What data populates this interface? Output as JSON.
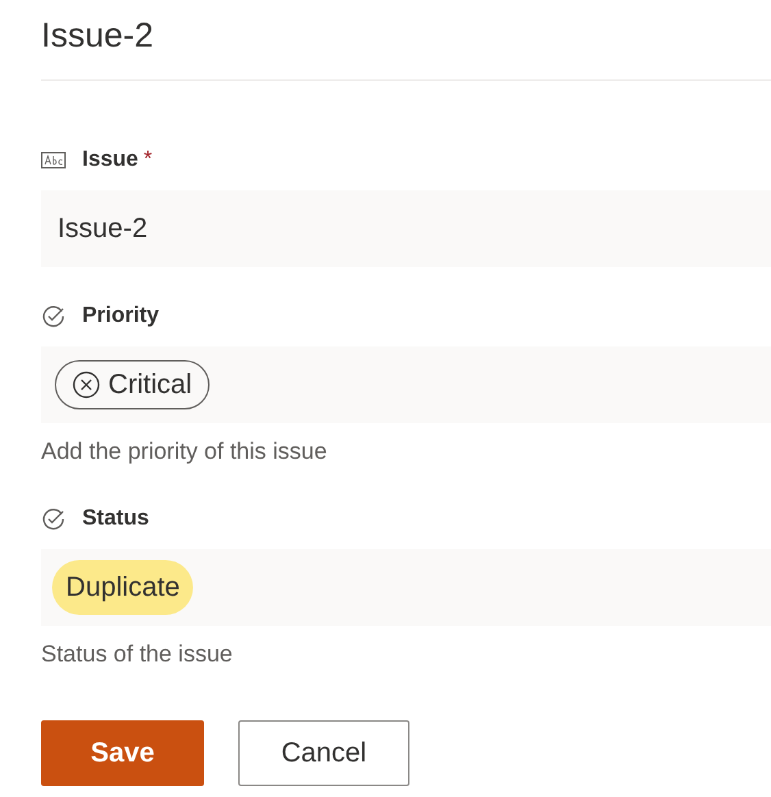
{
  "title": "Issue-2",
  "fields": [
    {
      "kind": "text",
      "label": "Issue",
      "required": true,
      "value": "Issue-2"
    },
    {
      "kind": "choice",
      "label": "Priority",
      "required": false,
      "choice": {
        "text": "Critical",
        "kind": "outlined"
      },
      "description": "Add the priority of this issue"
    },
    {
      "kind": "choice",
      "label": "Status",
      "required": false,
      "choice": {
        "text": "Duplicate",
        "kind": "filled"
      },
      "description": "Status of the issue"
    }
  ],
  "buttons": [
    {
      "label": "Save",
      "primary": true
    },
    {
      "label": "Cancel",
      "primary": false
    }
  ],
  "required_mark": "*"
}
